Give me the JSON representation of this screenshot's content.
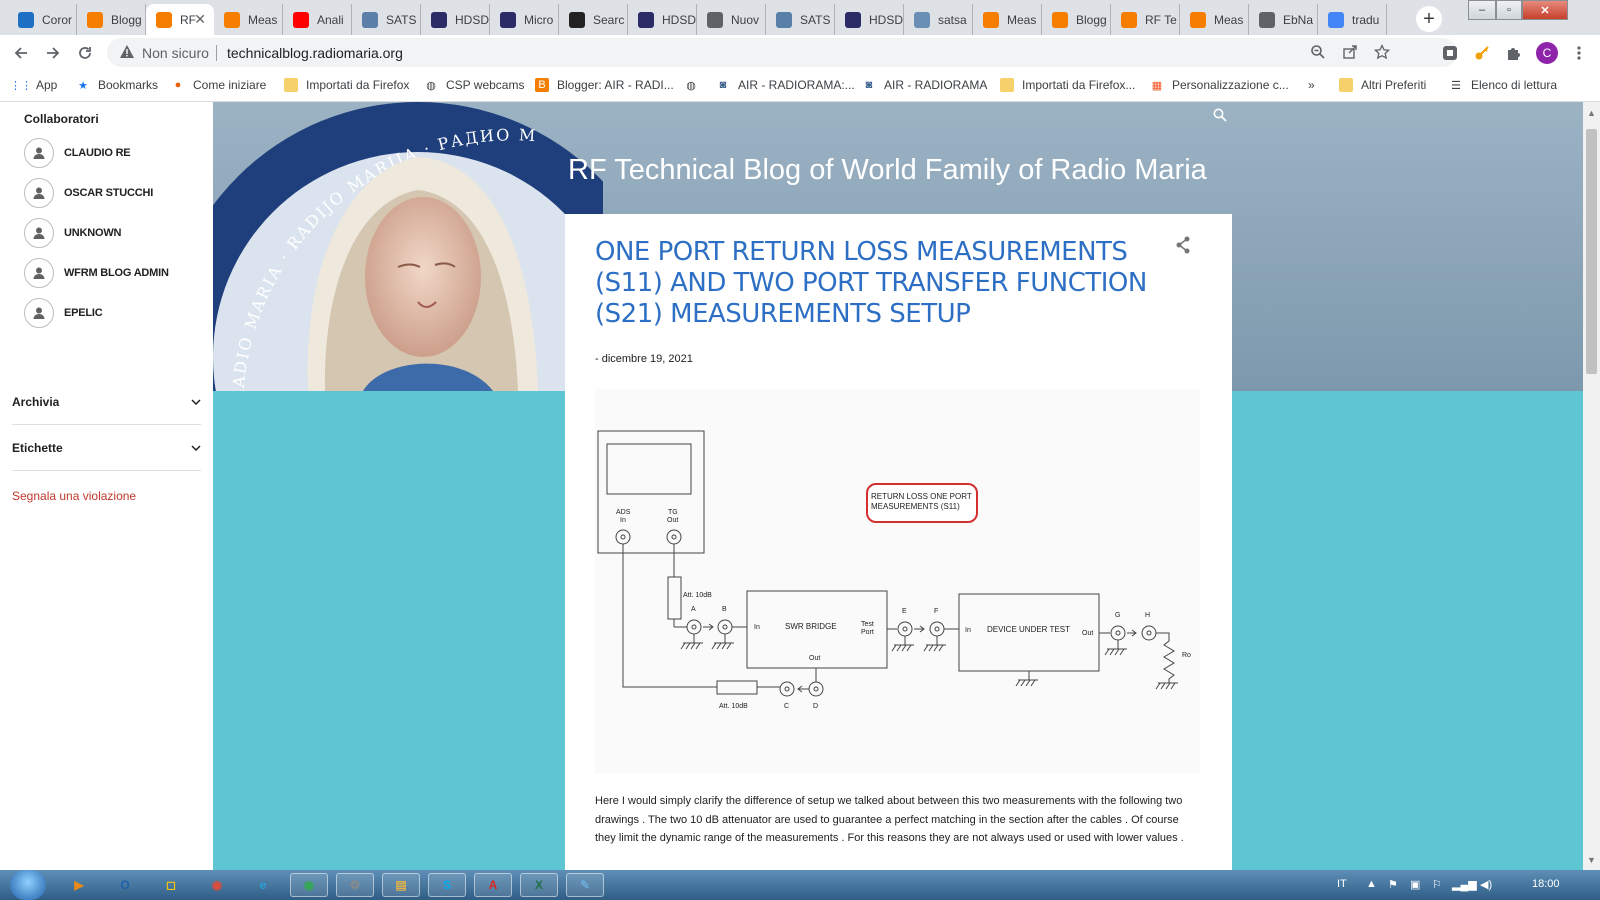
{
  "browser": {
    "tabs": [
      {
        "label": "Coror",
        "icon": "windows-app-icon",
        "color": "#1f6fc4"
      },
      {
        "label": "Blogg",
        "icon": "blogger-icon",
        "color": "#f57d00"
      },
      {
        "label": "RF",
        "icon": "blogger-icon",
        "color": "#f57d00",
        "active": true
      },
      {
        "label": "Meas",
        "icon": "blogger-icon",
        "color": "#f57d00"
      },
      {
        "label": "Anali",
        "icon": "youtube-icon",
        "color": "#ff0000"
      },
      {
        "label": "SATS",
        "icon": "site-icon",
        "color": "#5a7fa8"
      },
      {
        "label": "HDSD",
        "icon": "hdsd-icon",
        "color": "#2a2a66"
      },
      {
        "label": "Micro",
        "icon": "hdsd-icon",
        "color": "#2a2a66"
      },
      {
        "label": "Searc",
        "icon": "rtl-icon",
        "color": "#222222"
      },
      {
        "label": "HDSD",
        "icon": "hdsd-icon",
        "color": "#2a2a66"
      },
      {
        "label": "Nuov",
        "icon": "globe-icon",
        "color": "#5f6368"
      },
      {
        "label": "SATS",
        "icon": "site-icon",
        "color": "#5a7fa8"
      },
      {
        "label": "HDSD",
        "icon": "hdsd-icon",
        "color": "#2a2a66"
      },
      {
        "label": "satsa",
        "icon": "mail-icon",
        "color": "#6a8fb5"
      },
      {
        "label": "Meas",
        "icon": "blogger-icon",
        "color": "#f57d00"
      },
      {
        "label": "Blogg",
        "icon": "blogger-icon",
        "color": "#f57d00"
      },
      {
        "label": "RF Te",
        "icon": "blogger-icon",
        "color": "#f57d00"
      },
      {
        "label": "Meas",
        "icon": "blogger-icon",
        "color": "#f57d00"
      },
      {
        "label": "EbNa",
        "icon": "globe-icon",
        "color": "#5f6368"
      },
      {
        "label": "tradu",
        "icon": "google-icon",
        "color": "#4285f4"
      }
    ],
    "new_tab": "+",
    "window_controls": {
      "minimize": "–",
      "maximize": "▫",
      "close": "✕"
    },
    "security_label": "Non sicuro",
    "url": "technicalblog.radiomaria.org",
    "profile_initial": "C",
    "bookmarks": [
      {
        "label": "App",
        "icon": "apps-grid-icon"
      },
      {
        "label": "Bookmarks",
        "icon": "star-icon"
      },
      {
        "label": "Come iniziare",
        "icon": "firefox-icon"
      },
      {
        "label": "Importati da Firefox",
        "icon": "folder-icon"
      },
      {
        "label": "CSP webcams",
        "icon": "globe-icon"
      },
      {
        "label": "Blogger: AIR - RADI...",
        "icon": "blogger-icon"
      },
      {
        "label": "",
        "icon": "globe-icon"
      },
      {
        "label": "AIR - RADIORAMA:...",
        "icon": "site-icon"
      },
      {
        "label": "AIR - RADIORAMA",
        "icon": "site-icon"
      },
      {
        "label": "Importati da Firefox...",
        "icon": "folder-icon"
      },
      {
        "label": "Personalizzazione c...",
        "icon": "microsoft-icon"
      },
      {
        "label": "»",
        "icon": ""
      },
      {
        "label": "Altri Preferiti",
        "icon": "folder-icon"
      },
      {
        "label": "Elenco di lettura",
        "icon": "reading-list-icon"
      }
    ]
  },
  "sidebar": {
    "contributors_title": "Collaboratori",
    "contributors": [
      "CLAUDIO RE",
      "OSCAR STUCCHI",
      "UNKNOWN",
      "WFRM BLOG ADMIN",
      "EPELIC"
    ],
    "archive_label": "Archivia",
    "labels_label": "Etichette",
    "report_label": "Segnala una violazione"
  },
  "blog": {
    "title": "RF Technical Blog of World Family of Radio Maria",
    "emblem_text": "RADIO MARIA · RADIJO MARIJA · РАДИО МАРИЯ",
    "post": {
      "title": "ONE PORT RETURN LOSS MEASUREMENTS (S11) AND TWO PORT TRANSFER FUNCTION (S21) MEASUREMENTS SETUP",
      "date": "- dicembre 19, 2021",
      "body": "Here I would simply clarify the difference of setup we talked about between this two measurements with the following two drawings . The two 10 dB attenuator are used to guarantee a perfect matching in the section after the cables . Of course they limit the dynamic range of the measurements . For this reasons they are not always used or used with lower values ."
    },
    "diagram": {
      "label_box": "RETURN LOSS ONE PORT MEASUREMENTS (S11)",
      "ads_in": "ADS",
      "ads_in2": "In",
      "tg_out": "TG",
      "tg_out2": "Out",
      "att1": "Att. 10dB",
      "att2": "Att. 10dB",
      "a": "A",
      "b": "B",
      "c": "C",
      "d": "D",
      "e": "E",
      "f": "F",
      "g": "G",
      "h": "H",
      "swr": "SWR BRIDGE",
      "swr_in": "In",
      "swr_test1": "Test",
      "swr_test2": "Port",
      "swr_out": "Out",
      "dut": "DEVICE UNDER TEST",
      "dut_in": "In",
      "dut_out": "Out",
      "ro": "Ro"
    }
  },
  "taskbar": {
    "apps": [
      {
        "name": "media-player-icon",
        "label": "▶",
        "color": "#e8891a"
      },
      {
        "name": "outlook-icon",
        "label": "O",
        "color": "#1f5fa8"
      },
      {
        "name": "sticky-icon",
        "label": "◻",
        "color": "#f2c20f"
      },
      {
        "name": "chrome-icon",
        "label": "◉",
        "color": "#dd4b39"
      },
      {
        "name": "edge-icon",
        "label": "e",
        "color": "#2aa1d8"
      },
      {
        "name": "chrome-active-icon",
        "label": "◉",
        "color": "#34a853"
      },
      {
        "name": "tool-icon",
        "label": "⚙",
        "color": "#8a8a8a"
      },
      {
        "name": "explorer-icon",
        "label": "▤",
        "color": "#e0b24a"
      },
      {
        "name": "skype-icon",
        "label": "S",
        "color": "#00aff0"
      },
      {
        "name": "acrobat-icon",
        "label": "A",
        "color": "#d7261e"
      },
      {
        "name": "excel-icon",
        "label": "X",
        "color": "#1e7145"
      },
      {
        "name": "paint-icon",
        "label": "✎",
        "color": "#6da9d6"
      }
    ],
    "lang": "IT",
    "time": "18:00"
  }
}
